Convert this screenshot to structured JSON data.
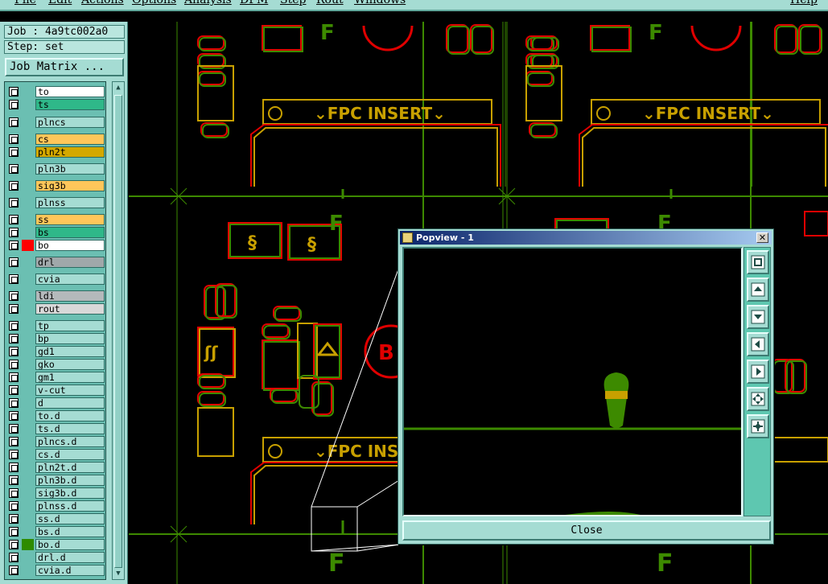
{
  "menu": {
    "file": "File",
    "edit": "Edit",
    "actions": "Actions",
    "options": "Options",
    "analysis": "Analysis",
    "dfm": "DFM",
    "step": "Step",
    "rout": "Rout",
    "windows": "Windows",
    "help": "Help"
  },
  "job": {
    "job_label": "Job : 4a9tc002a0",
    "step_label": "Step: set",
    "matrix_button": "Job Matrix ..."
  },
  "layers": [
    {
      "name": "to",
      "color": "#ffffff"
    },
    {
      "name": "ts",
      "color": "#2fb889"
    },
    {
      "name": "plncs",
      "color": "#a5dcd3"
    },
    {
      "name": "cs",
      "color": "#ffc65a"
    },
    {
      "name": "pln2t",
      "color": "#d4a800"
    },
    {
      "name": "pln3b",
      "color": "#a5dcd3"
    },
    {
      "name": "sig3b",
      "color": "#ffc65a"
    },
    {
      "name": "plnss",
      "color": "#a5dcd3"
    },
    {
      "name": "ss",
      "color": "#ffc65a"
    },
    {
      "name": "bs",
      "color": "#2fb889"
    },
    {
      "name": "bo",
      "color": "#ffffff",
      "swatch": "#ff0000"
    },
    {
      "name": "drl",
      "color": "#a0a8aa"
    },
    {
      "name": "cvia",
      "color": "#a5dcd3"
    },
    {
      "name": "ldi",
      "color": "#b4b9bb"
    },
    {
      "name": "rout",
      "color": "#d8d8d8"
    },
    {
      "name": "tp",
      "color": "#a5dcd3"
    },
    {
      "name": "bp",
      "color": "#a5dcd3"
    },
    {
      "name": "gd1",
      "color": "#a5dcd3"
    },
    {
      "name": "gko",
      "color": "#a5dcd3"
    },
    {
      "name": "gm1",
      "color": "#a5dcd3"
    },
    {
      "name": "v-cut",
      "color": "#a5dcd3"
    },
    {
      "name": "d",
      "color": "#a5dcd3"
    },
    {
      "name": "to.d",
      "color": "#a5dcd3"
    },
    {
      "name": "ts.d",
      "color": "#a5dcd3"
    },
    {
      "name": "plncs.d",
      "color": "#a5dcd3"
    },
    {
      "name": "cs.d",
      "color": "#a5dcd3"
    },
    {
      "name": "pln2t.d",
      "color": "#a5dcd3"
    },
    {
      "name": "pln3b.d",
      "color": "#a5dcd3"
    },
    {
      "name": "sig3b.d",
      "color": "#a5dcd3"
    },
    {
      "name": "plnss.d",
      "color": "#a5dcd3"
    },
    {
      "name": "ss.d",
      "color": "#a5dcd3"
    },
    {
      "name": "bs.d",
      "color": "#a5dcd3"
    },
    {
      "name": "bo.d",
      "color": "#a5dcd3",
      "swatch": "#2e8b00"
    },
    {
      "name": "drl.d",
      "color": "#a5dcd3"
    },
    {
      "name": "cvia.d",
      "color": "#a5dcd3"
    }
  ],
  "canvas": {
    "silk_text": "⌄FPC INSERT⌄",
    "silk_text_partial": "⌄FPC INS",
    "fiducial_label": "F"
  },
  "popview": {
    "title": "Popview - 1",
    "close_label": "Close",
    "tools": [
      "zoom-window-icon",
      "zoom-in-icon",
      "zoom-out-icon",
      "pan-left-icon",
      "pan-right-icon",
      "fit-icon",
      "center-icon"
    ]
  },
  "colors": {
    "panel": "#a5dcd3",
    "accent_green": "#3d8a00",
    "accent_red": "#e00000",
    "accent_yellow": "#c8a000",
    "title_bar": "#0a246a"
  }
}
